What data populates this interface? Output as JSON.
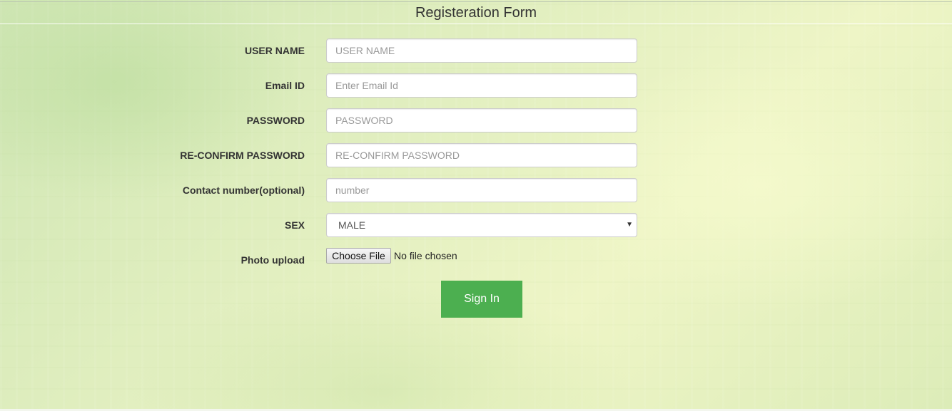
{
  "form": {
    "title": "Registeration Form",
    "fields": [
      {
        "label": "USER NAME",
        "value": "",
        "placeholder": "USER NAME"
      },
      {
        "label": "Email ID",
        "value": "",
        "placeholder": "Enter Email Id"
      },
      {
        "label": "PASSWORD",
        "value": "",
        "placeholder": "PASSWORD"
      },
      {
        "label": "RE-CONFIRM PASSWORD",
        "value": "",
        "placeholder": "RE-CONFIRM PASSWORD"
      },
      {
        "label": "Contact number(optional)",
        "value": "",
        "placeholder": "number"
      }
    ],
    "sex": {
      "label": "SEX",
      "selected": "MALE"
    },
    "photo": {
      "label": "Photo upload",
      "button_label": "Choose File",
      "status": "No file chosen"
    },
    "submit_label": "Sign In"
  },
  "colors": {
    "accent": "#4caf50",
    "background": "#e2efc0"
  }
}
